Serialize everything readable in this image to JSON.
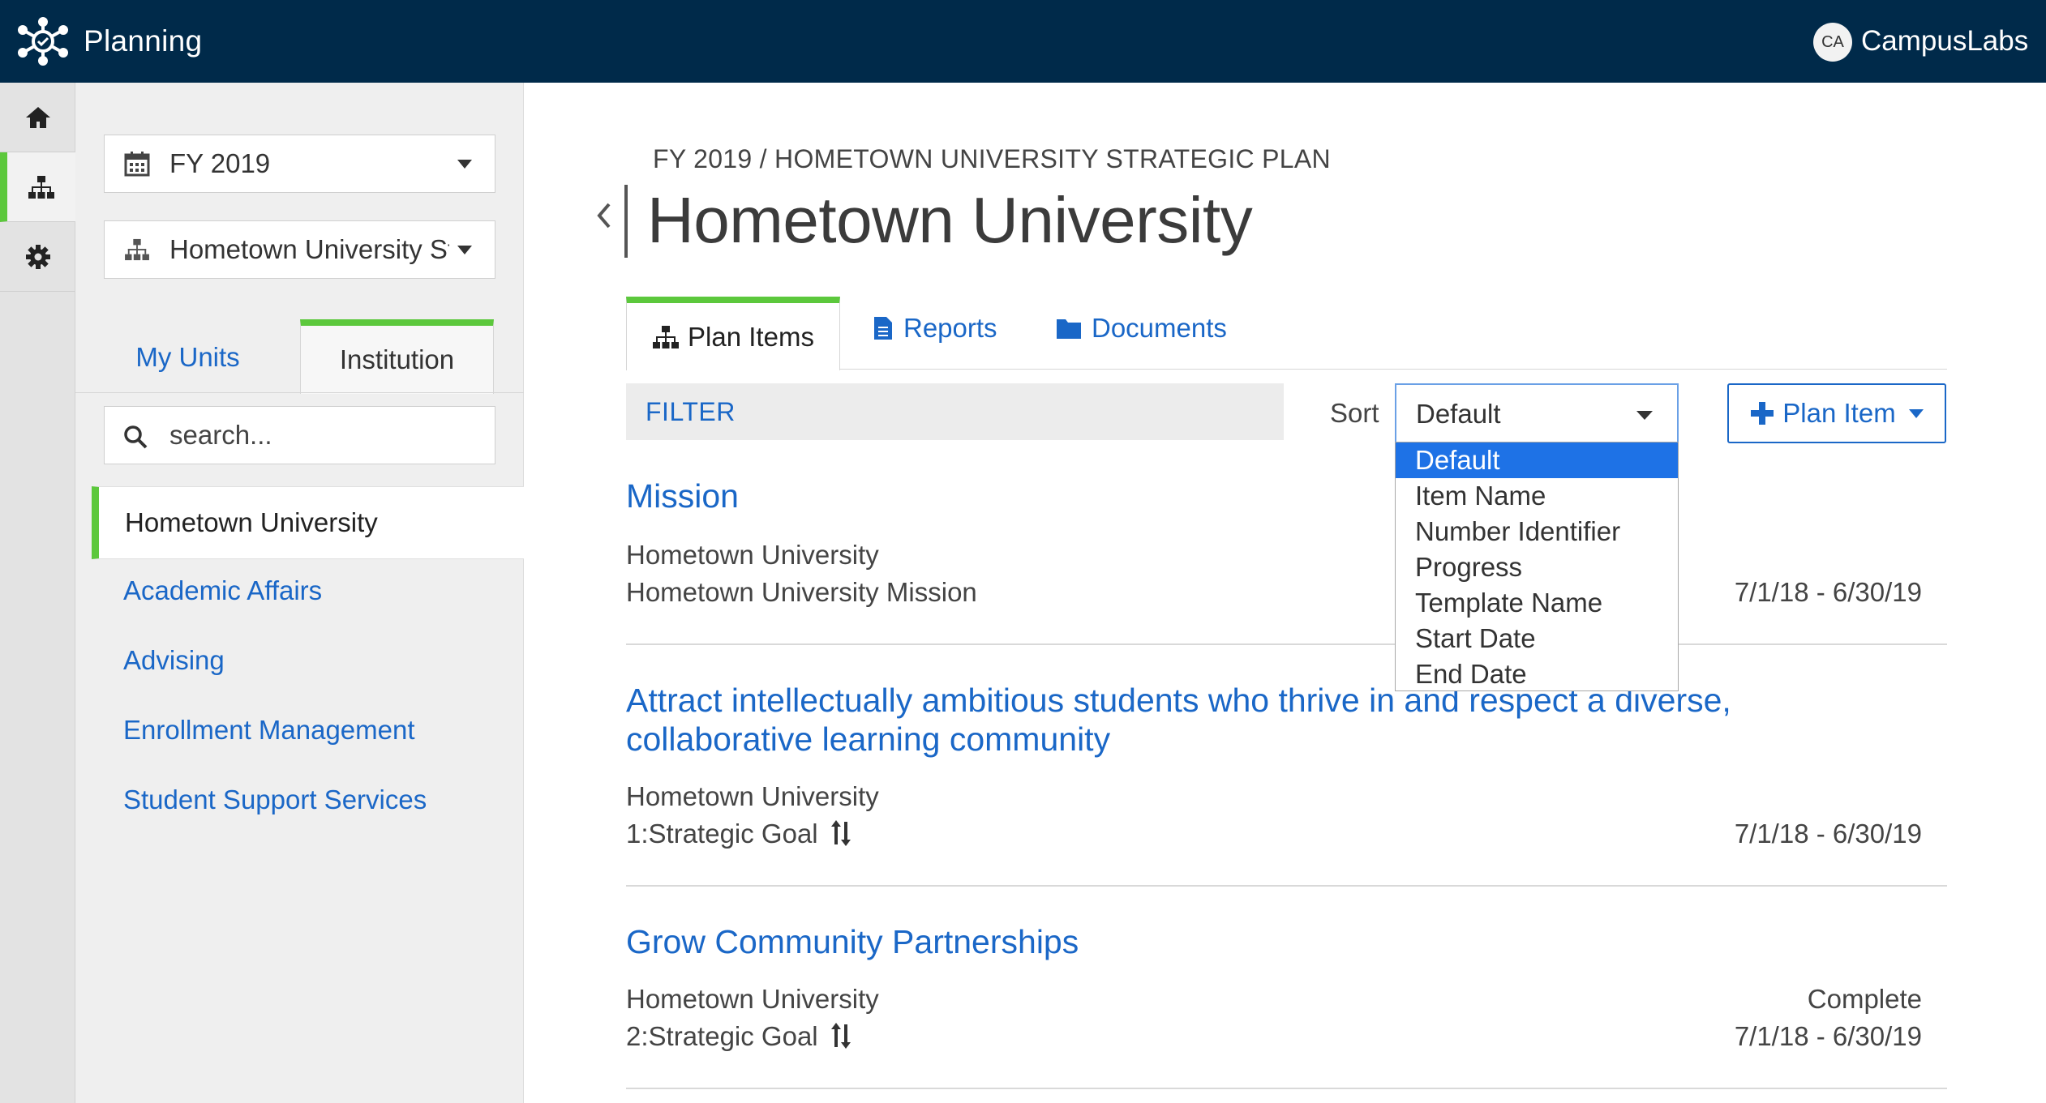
{
  "header": {
    "app_title": "Planning",
    "avatar_initials": "CA",
    "brand": "CampusLabs"
  },
  "rail": {
    "items": [
      "home-icon",
      "sitemap-icon",
      "gear-icon"
    ],
    "active_index": 1
  },
  "sidebar": {
    "year_select": "FY 2019",
    "plan_select": "Hometown University Strategic Plan",
    "tabs": [
      "My Units",
      "Institution"
    ],
    "active_tab": "Institution",
    "search_placeholder": "search...",
    "units": [
      "Hometown University",
      "Academic Affairs",
      "Advising",
      "Enrollment Management",
      "Student Support Services"
    ],
    "active_unit": "Hometown University"
  },
  "main": {
    "breadcrumb": "FY 2019 / HOMETOWN UNIVERSITY STRATEGIC PLAN",
    "title": "Hometown University",
    "tabs": [
      "Plan Items",
      "Reports",
      "Documents"
    ],
    "filter_label": "FILTER",
    "sort_label": "Sort",
    "sort_value": "Default",
    "sort_options": [
      "Default",
      "Item Name",
      "Number Identifier",
      "Progress",
      "Template Name",
      "Start Date",
      "End Date"
    ],
    "add_button": "Plan Item",
    "items": [
      {
        "title": "Mission",
        "unit": "Hometown University",
        "type": "Hometown University Mission",
        "status": "",
        "dates": "7/1/18 - 6/30/19"
      },
      {
        "title": "Attract intellectually ambitious students who thrive in and respect a diverse, collaborative learning community",
        "unit": "Hometown University",
        "type": "1:Strategic Goal",
        "status": "",
        "dates": "7/1/18 - 6/30/19"
      },
      {
        "title": "Grow Community Partnerships",
        "unit": "Hometown University",
        "type": "2:Strategic Goal",
        "status": "Complete",
        "dates": "7/1/18 - 6/30/19"
      }
    ]
  },
  "colors": {
    "topbar": "#002a4a",
    "accent_green": "#5cc83c",
    "link_blue": "#1a67c7",
    "selected_blue": "#1e72e6"
  }
}
